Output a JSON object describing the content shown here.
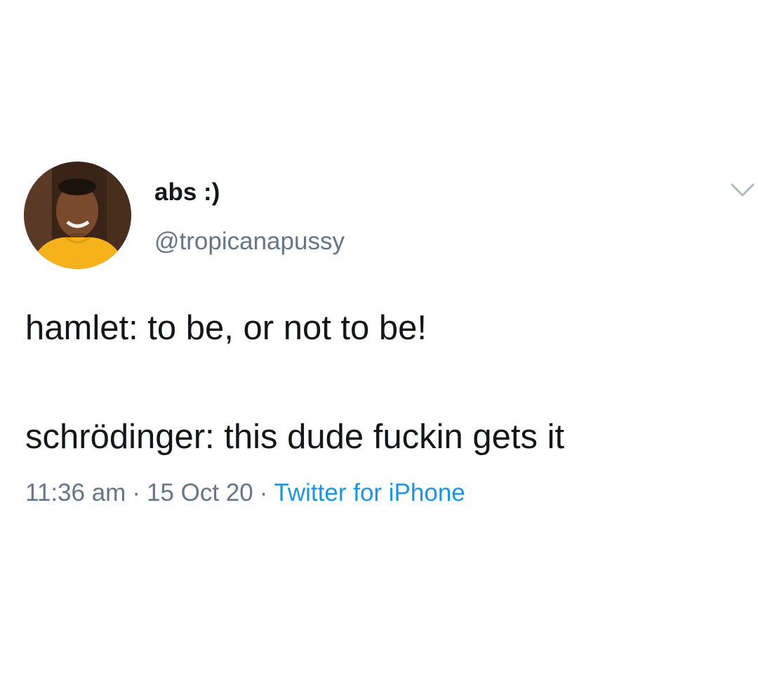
{
  "tweet": {
    "author": {
      "display_name": "abs :)",
      "handle": "@tropicanapussy",
      "avatar_icon": "profile-photo"
    },
    "menu_icon": "chevron-down-icon",
    "text_lines": [
      "hamlet: to be, or not to be!",
      "schrödinger: this dude fuckin gets it"
    ],
    "meta": {
      "time": "11:36 am",
      "separator": "·",
      "date": "15 Oct 20",
      "source": "Twitter for iPhone"
    }
  },
  "colors": {
    "text_primary": "#14171a",
    "text_secondary": "#657786",
    "link": "#1b95e0",
    "chevron": "#aab8c2",
    "avatar_shirt": "#f6b21a"
  }
}
